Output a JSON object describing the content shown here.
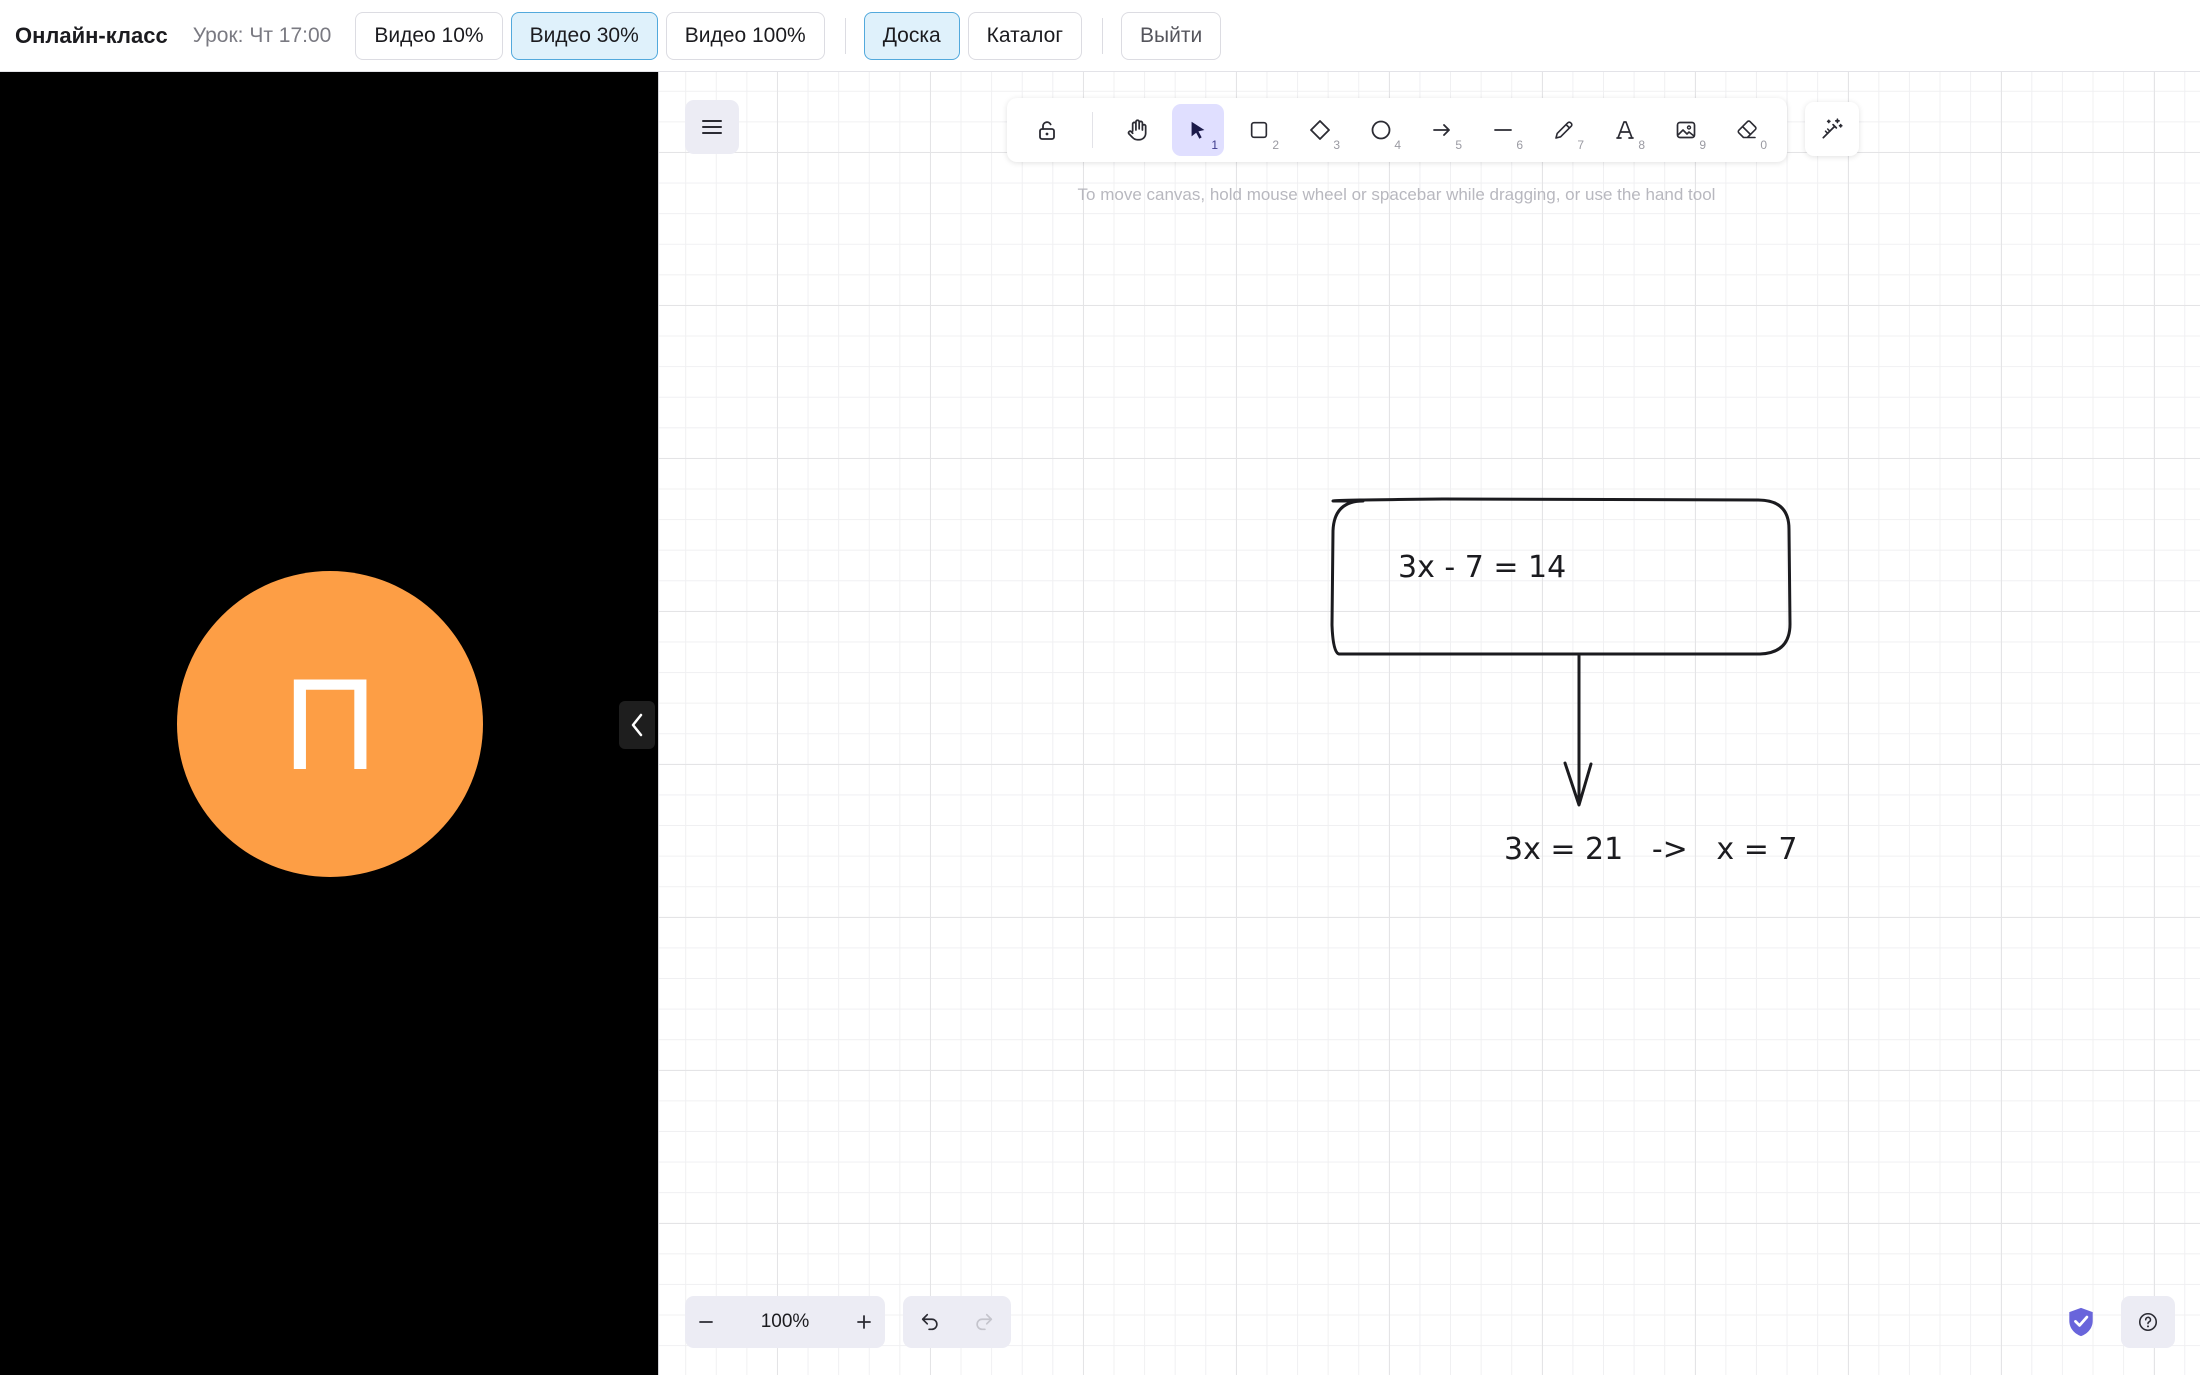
{
  "header": {
    "app_title": "Онлайн-класс",
    "lesson": "Урок: Чт 17:00",
    "buttons": {
      "video10": "Видео 10%",
      "video30": "Видео 30%",
      "video100": "Видео 100%",
      "board": "Доска",
      "catalog": "Каталог",
      "logout": "Выйти"
    },
    "active_video": "Видео 30%",
    "active_view": "Доска"
  },
  "video": {
    "avatar_letter": "П",
    "avatar_color": "#fd9e45",
    "collapse_icon": "chevron-left-icon"
  },
  "whiteboard": {
    "toolbar": {
      "tools": [
        {
          "name": "lock-icon",
          "shortcut": ""
        },
        {
          "name": "hand-icon",
          "shortcut": ""
        },
        {
          "name": "select-arrow-icon",
          "shortcut": "1",
          "selected": true
        },
        {
          "name": "rectangle-icon",
          "shortcut": "2"
        },
        {
          "name": "diamond-icon",
          "shortcut": "3"
        },
        {
          "name": "ellipse-icon",
          "shortcut": "4"
        },
        {
          "name": "arrow-icon",
          "shortcut": "5"
        },
        {
          "name": "line-icon",
          "shortcut": "6"
        },
        {
          "name": "pencil-icon",
          "shortcut": "7"
        },
        {
          "name": "text-icon",
          "shortcut": "8"
        },
        {
          "name": "image-icon",
          "shortcut": "9"
        },
        {
          "name": "eraser-icon",
          "shortcut": "0"
        }
      ],
      "accent": "#e0dfff"
    },
    "hint": "To move canvas, hold mouse wheel or spacebar while dragging, or use the hand tool",
    "canvas": {
      "box_equation": "3x - 7 = 14",
      "result_equation": "3x = 21   ->   x = 7"
    },
    "footer": {
      "zoom": "100%"
    }
  }
}
